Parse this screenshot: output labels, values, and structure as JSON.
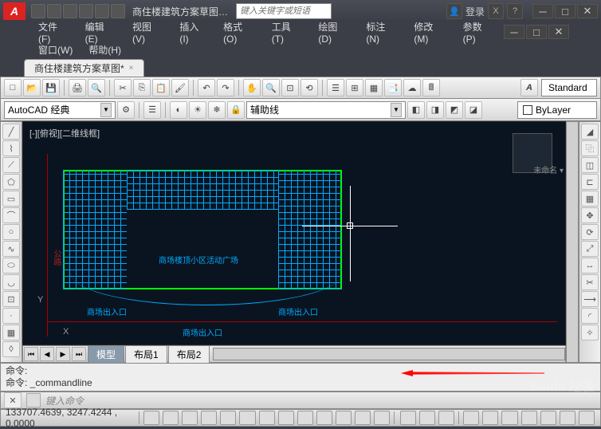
{
  "title": {
    "doc": "商住楼建筑方案草图…",
    "dots": "…"
  },
  "search": {
    "placeholder": "键入关键字或短语"
  },
  "login": "登录",
  "menus": {
    "file": "文件(F)",
    "edit": "编辑(E)",
    "view": "视图(V)",
    "insert": "插入(I)",
    "format": "格式(O)",
    "tools": "工具(T)",
    "draw": "绘图(D)",
    "annotate": "标注(N)",
    "modify": "修改(M)",
    "params": "参数(P)",
    "window": "窗口(W)",
    "help": "帮助(H)"
  },
  "doctab": {
    "name": "商住楼建筑方案草图*",
    "close": "×"
  },
  "workspace": {
    "label": "AutoCAD 经典",
    "aux": "辅助线"
  },
  "style": {
    "label": "Standard"
  },
  "layer": {
    "label": "ByLayer"
  },
  "canvas": {
    "viewlabel": "[-][俯视][二维线框]",
    "vclabel": "未命名 ▾",
    "ucsx": "X",
    "ucsy": "Y",
    "bldg_center": "商场楼顶小区活动广场",
    "exit_l": "商场出入口",
    "exit_r": "商场出入口",
    "exit_b": "商场出入口",
    "road": "公路"
  },
  "tabs": {
    "model": "模型",
    "layout1": "布局1",
    "layout2": "布局2"
  },
  "cmd": {
    "line1": "命令:",
    "line2": "命令: _commandline",
    "input": "键入命令"
  },
  "status": {
    "coords": "133707.4639, 3247.4244 , 0.0000"
  },
  "watermark": "Baidu 经验"
}
